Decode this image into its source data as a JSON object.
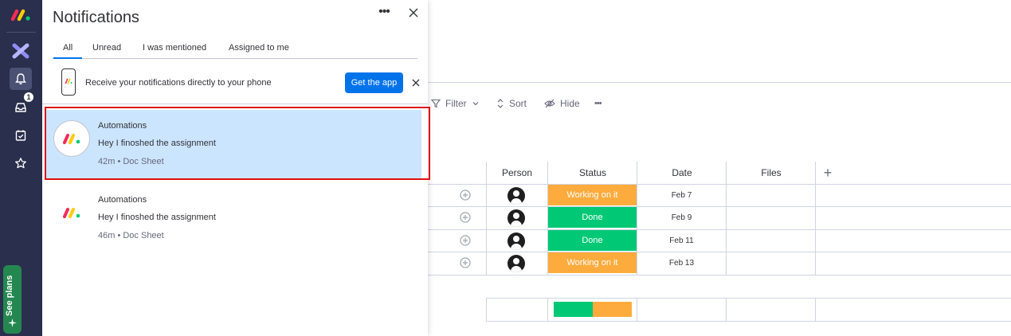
{
  "rail": {
    "inbox_badge": "1",
    "see_plans": "See plans"
  },
  "panel": {
    "title": "Notifications",
    "more_label": "•••",
    "tabs": [
      {
        "label": "All",
        "active": true
      },
      {
        "label": "Unread",
        "active": false
      },
      {
        "label": "I was mentioned",
        "active": false
      },
      {
        "label": "Assigned to me",
        "active": false
      }
    ],
    "promo": {
      "text": "Receive your notifications directly to your phone",
      "button": "Get the app"
    },
    "notifications": [
      {
        "sender": "Automations",
        "message": "Hey I finoshed the assignment",
        "meta": "42m •  Doc Sheet",
        "selected": true
      },
      {
        "sender": "Automations",
        "message": "Hey I finoshed the assignment",
        "meta": "46m •  Doc Sheet",
        "selected": false
      }
    ]
  },
  "board": {
    "toolbar": {
      "filter": "Filter",
      "sort": "Sort",
      "hide": "Hide",
      "more": "•••"
    },
    "columns": {
      "person": "Person",
      "status": "Status",
      "date": "Date",
      "files": "Files",
      "add": "+"
    },
    "rows": [
      {
        "status": "Working on it",
        "status_color": "#fdab3d",
        "date": "Feb 7"
      },
      {
        "status": "Done",
        "status_color": "#00c875",
        "date": "Feb 9"
      },
      {
        "status": "Done",
        "status_color": "#00c875",
        "date": "Feb 11"
      },
      {
        "status": "Working on it",
        "status_color": "#fdab3d",
        "date": "Feb 13"
      }
    ],
    "status_summary": {
      "done_fraction": 0.5,
      "working_fraction": 0.5
    }
  },
  "colors": {
    "accent": "#0073ea",
    "rail": "#292f4c",
    "selected": "#cce5ff",
    "highlight": "#e01010"
  }
}
